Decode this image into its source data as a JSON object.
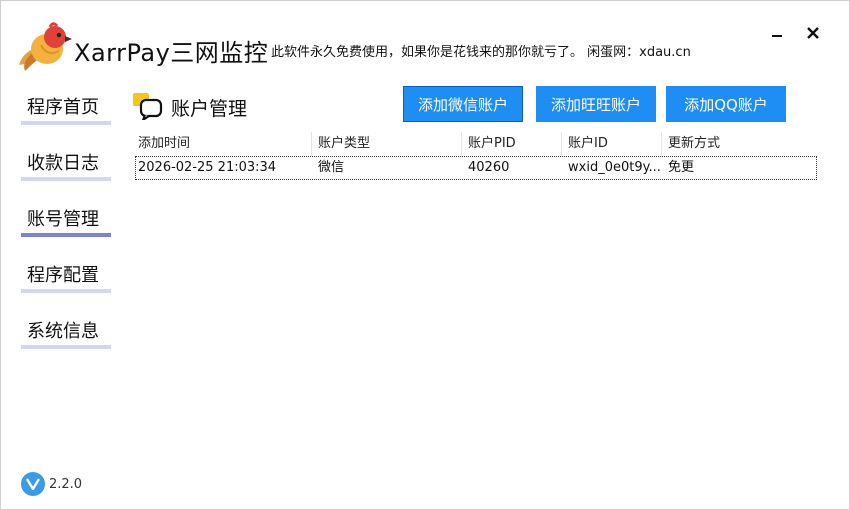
{
  "app": {
    "title": "XarrPay三网监控",
    "slogan": "此软件永久免费使用，如果你是花钱来的那你就亏了。 闲蛋网：xdau.cn",
    "version": "2.2.0"
  },
  "sidebar": {
    "items": [
      {
        "label": "程序首页",
        "active": false
      },
      {
        "label": "收款日志",
        "active": false
      },
      {
        "label": "账号管理",
        "active": true
      },
      {
        "label": "程序配置",
        "active": false
      },
      {
        "label": "系统信息",
        "active": false
      }
    ]
  },
  "main": {
    "title": "账户管理",
    "buttons": {
      "add_wechat": "添加微信账户",
      "add_wangwang": "添加旺旺账户",
      "add_qq": "添加QQ账户"
    },
    "table": {
      "columns": [
        "添加时间",
        "账户类型",
        "账户PID",
        "账户ID",
        "更新方式"
      ],
      "rows": [
        [
          "2026-02-25 21:03:34",
          "微信",
          "40260",
          "wxid_0e0t9y...",
          "免更"
        ]
      ]
    }
  },
  "colors": {
    "accent": "#1e8ef5",
    "sidebar_underline": "#d3d6f2",
    "sidebar_active_underline": "#7b83d6"
  }
}
